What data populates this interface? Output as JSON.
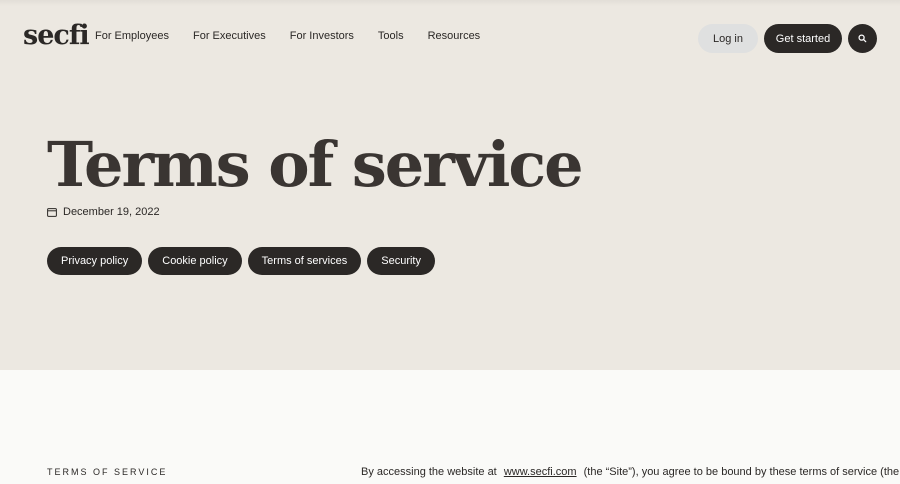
{
  "header": {
    "logo": "secfi",
    "nav": [
      "For Employees",
      "For Executives",
      "For Investors",
      "Tools",
      "Resources"
    ],
    "login_label": "Log in",
    "get_started_label": "Get started",
    "search_icon": "search-icon"
  },
  "hero": {
    "title": "Terms of service",
    "date": "December 19, 2022",
    "date_icon": "calendar-icon",
    "pills": [
      "Privacy policy",
      "Cookie policy",
      "Terms of services",
      "Security"
    ]
  },
  "content": {
    "section_label": "TERMS OF SERVICE",
    "intro_before": "By accessing the website at",
    "intro_link": "www.secfi.com",
    "intro_after": "(the “Site”), you agree to be bound by these terms of service (the"
  },
  "colors": {
    "hero_bg": "#ece8e1",
    "dark": "#2b2826",
    "login_bg": "#dfe0e0",
    "page_bg": "#fafaf8"
  }
}
